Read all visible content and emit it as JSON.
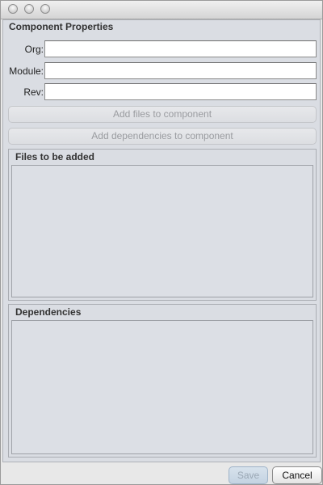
{
  "window": {
    "controls": [
      "close-icon",
      "minimize-icon",
      "zoom-icon"
    ]
  },
  "section": {
    "title": "Component Properties"
  },
  "fields": {
    "org": {
      "label": "Org:",
      "value": ""
    },
    "module": {
      "label": "Module:",
      "value": ""
    },
    "rev": {
      "label": "Rev:",
      "value": ""
    }
  },
  "actions": {
    "add_files": "Add files to component",
    "add_dependencies": "Add dependencies to component"
  },
  "files_panel": {
    "title": "Files to be added"
  },
  "dependencies_panel": {
    "title": "Dependencies"
  },
  "footer": {
    "save": "Save",
    "cancel": "Cancel"
  }
}
